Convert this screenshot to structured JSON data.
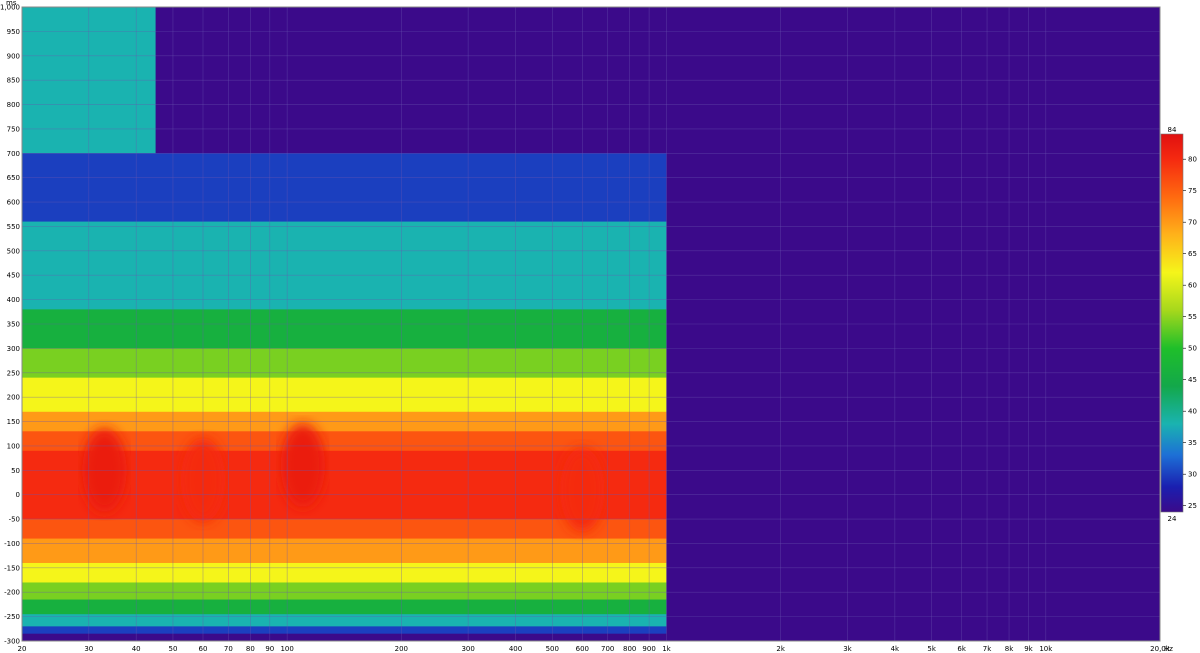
{
  "chart_data": {
    "type": "heatmap",
    "subtype": "wavelet-spectrogram",
    "x_scale": "log",
    "xlim": [
      20,
      20000
    ],
    "ylim": [
      -300,
      1000
    ],
    "y_unit": "ms",
    "x_unit": "Hz",
    "x_ticks": [
      {
        "value": 20,
        "label": "20"
      },
      {
        "value": 30,
        "label": "30"
      },
      {
        "value": 40,
        "label": "40"
      },
      {
        "value": 50,
        "label": "50"
      },
      {
        "value": 60,
        "label": "60"
      },
      {
        "value": 70,
        "label": "70"
      },
      {
        "value": 80,
        "label": "80"
      },
      {
        "value": 90,
        "label": "90"
      },
      {
        "value": 100,
        "label": "100"
      },
      {
        "value": 200,
        "label": "200"
      },
      {
        "value": 300,
        "label": "300"
      },
      {
        "value": 400,
        "label": "400"
      },
      {
        "value": 500,
        "label": "500"
      },
      {
        "value": 600,
        "label": "600"
      },
      {
        "value": 700,
        "label": "700"
      },
      {
        "value": 800,
        "label": "800"
      },
      {
        "value": 900,
        "label": "900"
      },
      {
        "value": 1000,
        "label": "1k"
      },
      {
        "value": 2000,
        "label": "2k"
      },
      {
        "value": 3000,
        "label": "3k"
      },
      {
        "value": 4000,
        "label": "4k"
      },
      {
        "value": 5000,
        "label": "5k"
      },
      {
        "value": 6000,
        "label": "6k"
      },
      {
        "value": 7000,
        "label": "7k"
      },
      {
        "value": 8000,
        "label": "8k"
      },
      {
        "value": 9000,
        "label": "9k"
      },
      {
        "value": 10000,
        "label": "10k"
      },
      {
        "value": 20000,
        "label": "20,0k"
      }
    ],
    "y_ticks": [
      {
        "value": 1000,
        "label": "1,000"
      },
      {
        "value": 950,
        "label": "950"
      },
      {
        "value": 900,
        "label": "900"
      },
      {
        "value": 850,
        "label": "850"
      },
      {
        "value": 800,
        "label": "800"
      },
      {
        "value": 750,
        "label": "750"
      },
      {
        "value": 700,
        "label": "700"
      },
      {
        "value": 650,
        "label": "650"
      },
      {
        "value": 600,
        "label": "600"
      },
      {
        "value": 550,
        "label": "550"
      },
      {
        "value": 500,
        "label": "500"
      },
      {
        "value": 450,
        "label": "450"
      },
      {
        "value": 400,
        "label": "400"
      },
      {
        "value": 350,
        "label": "350"
      },
      {
        "value": 300,
        "label": "300"
      },
      {
        "value": 250,
        "label": "250"
      },
      {
        "value": 200,
        "label": "200"
      },
      {
        "value": 150,
        "label": "150"
      },
      {
        "value": 100,
        "label": "100"
      },
      {
        "value": 50,
        "label": "50"
      },
      {
        "value": 0,
        "label": "0"
      },
      {
        "value": -50,
        "label": "-50"
      },
      {
        "value": -100,
        "label": "-100"
      },
      {
        "value": -150,
        "label": "-150"
      },
      {
        "value": -200,
        "label": "-200"
      },
      {
        "value": -250,
        "label": "-250"
      },
      {
        "value": -300,
        "label": "-300"
      }
    ],
    "x_unit_label": "Hz",
    "y_unit_label": "ms",
    "grid": true,
    "colorbar": {
      "placement": "right",
      "min": 24,
      "max": 84,
      "min_label": "24",
      "max_label": "84",
      "ticks": [
        {
          "value": 80,
          "label": "80"
        },
        {
          "value": 75,
          "label": "75"
        },
        {
          "value": 70,
          "label": "70"
        },
        {
          "value": 65,
          "label": "65"
        },
        {
          "value": 60,
          "label": "60"
        },
        {
          "value": 55,
          "label": "55"
        },
        {
          "value": 50,
          "label": "50"
        },
        {
          "value": 45,
          "label": "45"
        },
        {
          "value": 40,
          "label": "40"
        },
        {
          "value": 35,
          "label": "35"
        },
        {
          "value": 30,
          "label": "30"
        },
        {
          "value": 25,
          "label": "25"
        }
      ],
      "stops": [
        {
          "value": 24,
          "color": "#3b0a8a"
        },
        {
          "value": 28,
          "color": "#1a1fb0"
        },
        {
          "value": 33,
          "color": "#1d6fd6"
        },
        {
          "value": 38,
          "color": "#1ab3b0"
        },
        {
          "value": 44,
          "color": "#13a84a"
        },
        {
          "value": 50,
          "color": "#1fbf2a"
        },
        {
          "value": 56,
          "color": "#a6d81c"
        },
        {
          "value": 62,
          "color": "#f5f51a"
        },
        {
          "value": 68,
          "color": "#ffb21a"
        },
        {
          "value": 74,
          "color": "#ff6a10"
        },
        {
          "value": 80,
          "color": "#f52a10"
        },
        {
          "value": 84,
          "color": "#e01010"
        }
      ]
    },
    "background_color": "#3b0a8a",
    "data_extent_hz": [
      20,
      1000
    ],
    "approx_energy": {
      "main_band_ms": [
        -50,
        150
      ],
      "peak_level": 82,
      "floor_level": 24,
      "onset_ms": -250,
      "features": [
        {
          "freq_hz": 33,
          "level": 82,
          "time_ms": 50
        },
        {
          "freq_hz": 60,
          "level": 80,
          "time_ms": 30
        },
        {
          "freq_hz": 110,
          "level": 82,
          "time_ms": 60
        },
        {
          "freq_hz": 600,
          "level": 80,
          "time_ms": 10
        }
      ]
    }
  }
}
